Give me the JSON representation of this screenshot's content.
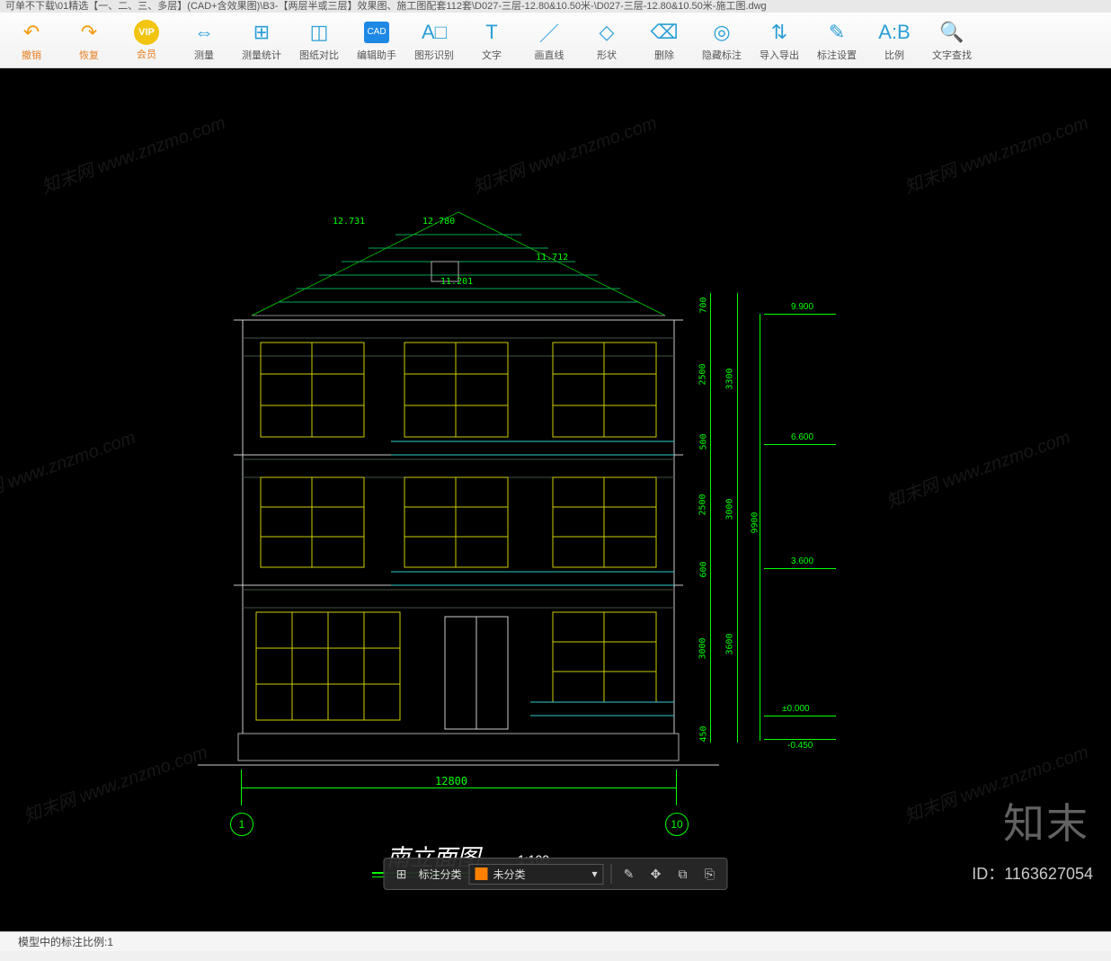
{
  "title_path": "可单不下载\\01精选【一、二、三、多层】(CAD+含效果图)\\B3-【两层半或三层】效果图、施工图配套112套\\D027-三层-12.80&10.50米-\\D027-三层-12.80&10.50米-施工图.dwg",
  "toolbar": [
    {
      "id": "undo",
      "label": "撤销",
      "icon": "↶",
      "cls": "orange"
    },
    {
      "id": "redo",
      "label": "恢复",
      "icon": "↷",
      "cls": "orange"
    },
    {
      "id": "vip",
      "label": "会员",
      "icon": "VIP",
      "cls": "vip"
    },
    {
      "id": "measure",
      "label": "测量",
      "icon": "⇔"
    },
    {
      "id": "measure-stat",
      "label": "测量统计",
      "icon": "⊞"
    },
    {
      "id": "compare",
      "label": "图纸对比",
      "icon": "◫"
    },
    {
      "id": "edit-assist",
      "label": "编辑助手",
      "icon": "CAD",
      "cls": "bluebox"
    },
    {
      "id": "recognize",
      "label": "图形识别",
      "icon": "A□"
    },
    {
      "id": "text",
      "label": "文字",
      "icon": "T"
    },
    {
      "id": "line",
      "label": "画直线",
      "icon": "／"
    },
    {
      "id": "shape",
      "label": "形状",
      "icon": "◇"
    },
    {
      "id": "delete",
      "label": "删除",
      "icon": "⌫"
    },
    {
      "id": "hide-annot",
      "label": "隐藏标注",
      "icon": "◎"
    },
    {
      "id": "import-export",
      "label": "导入导出",
      "icon": "⇅"
    },
    {
      "id": "annot-settings",
      "label": "标注设置",
      "icon": "✎"
    },
    {
      "id": "ratio",
      "label": "比例",
      "icon": "A:B"
    },
    {
      "id": "text-find",
      "label": "文字查找",
      "icon": "🔍"
    }
  ],
  "drawing": {
    "title": "南立面图",
    "scale": "1:100",
    "width_label": "12800",
    "grid_left": "1",
    "grid_right": "10",
    "roof_dims": {
      "left": "12.731",
      "mid": "12.780",
      "peak": "11.201",
      "right": "11.712"
    },
    "levels": [
      "9.900",
      "6.600",
      "3.600",
      "±0.000",
      "-0.450"
    ],
    "v_dims_inner": [
      "700",
      "2500",
      "500",
      "2500",
      "600",
      "3000",
      "450"
    ],
    "v_dims_outer": [
      "3300",
      "3000",
      "3600"
    ],
    "v_total": "9900"
  },
  "bottom_bar": {
    "group_icon": "⊞",
    "label": "标注分类",
    "category": "未分类"
  },
  "brand": "知末",
  "image_id": "ID：1163627054",
  "statusbar": "模型中的标注比例:1",
  "watermark_text": "知末网 www.znzmo.com"
}
